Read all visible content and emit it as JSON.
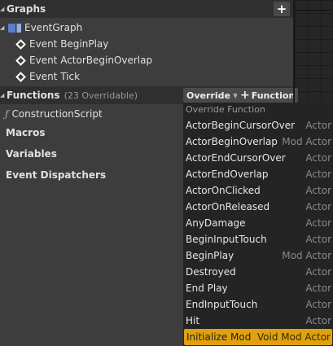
{
  "graphs": {
    "title": "Graphs",
    "add": "+",
    "event_graph": "EventGraph",
    "events": [
      "Event BeginPlay",
      "Event ActorBeginOverlap",
      "Event Tick"
    ]
  },
  "functions": {
    "title": "Functions",
    "count": "(23 Overridable)",
    "override_label": "Override",
    "add_function_label": "Function",
    "items": [
      "ConstructionScript"
    ]
  },
  "sections": {
    "macros": "Macros",
    "variables": "Variables",
    "dispatchers": "Event Dispatchers"
  },
  "dropdown": {
    "header": "Override Function",
    "items": [
      {
        "name": "ActorBeginCursorOver",
        "type": "Actor"
      },
      {
        "name": "ActorBeginOverlap",
        "type": "Mod Actor"
      },
      {
        "name": "ActorEndCursorOver",
        "type": "Actor"
      },
      {
        "name": "ActorEndOverlap",
        "type": "Actor"
      },
      {
        "name": "ActorOnClicked",
        "type": "Actor"
      },
      {
        "name": "ActorOnReleased",
        "type": "Actor"
      },
      {
        "name": "AnyDamage",
        "type": "Actor"
      },
      {
        "name": "BeginInputTouch",
        "type": "Actor"
      },
      {
        "name": "BeginPlay",
        "type": "Mod Actor"
      },
      {
        "name": "Destroyed",
        "type": "Actor"
      },
      {
        "name": "End Play",
        "type": "Actor"
      },
      {
        "name": "EndInputTouch",
        "type": "Actor"
      },
      {
        "name": "Hit",
        "type": "Actor"
      },
      {
        "name": "Initialize Mod",
        "type": "Void Mod Actor"
      }
    ],
    "selected_index": 13,
    "highlight_color": "#e0a10f"
  }
}
